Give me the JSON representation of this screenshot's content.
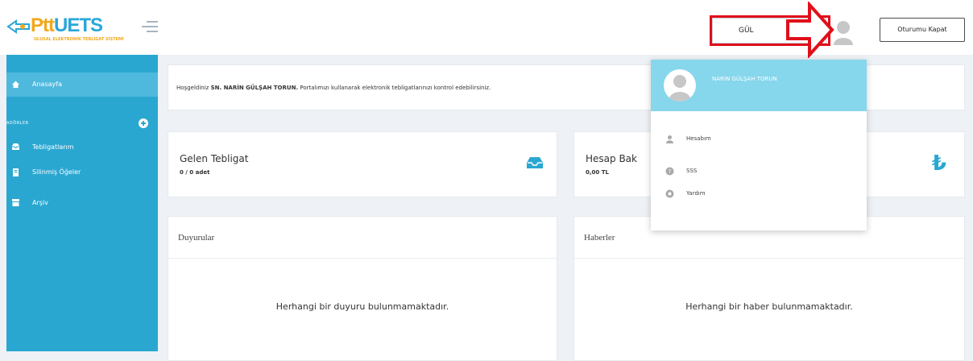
{
  "header": {
    "logo": {
      "brand_ptt": "Ptt",
      "brand_uets": "UETS",
      "tagline": "ULUSAL ELEKTRONİK TEBLİGAT SİSTEMİ"
    },
    "user_select": {
      "value": "GÜL"
    },
    "logout_label": "Oturumu Kapat"
  },
  "sidebar": {
    "home_label": "Anasayfa",
    "section_label": "ADÖRLER",
    "items": [
      {
        "label": "Tebligatlarım",
        "icon": "inbox-icon"
      },
      {
        "label": "Silinmiş Öğeler",
        "icon": "trash-icon"
      },
      {
        "label": "Arşiv",
        "icon": "archive-icon"
      }
    ]
  },
  "welcome": {
    "prefix": "Hoşgeldiniz",
    "name": "SN. NARİN GÜLŞAH TORUN.",
    "suffix": "Portalımızı kullanarak elektronik tebligatlarınızı kontrol edebilirsiniz."
  },
  "stats": {
    "gelen": {
      "title": "Gelen Tebligat",
      "value": "0 / 0 adet"
    },
    "hesap": {
      "title": "Hesap Bak",
      "value": "0,00 TL"
    }
  },
  "panels": {
    "duyurular": {
      "title": "Duyurular",
      "empty": "Herhangi bir duyuru bulunmamaktadır."
    },
    "haberler": {
      "title": "Haberler",
      "empty": "Herhangi bir haber bulunmamaktadır."
    }
  },
  "user_menu": {
    "name": "NARİN GÜLŞAH TORUN",
    "items": [
      {
        "label": "Hesabım",
        "icon": "user-icon"
      },
      {
        "label": "SSS",
        "icon": "question-icon"
      },
      {
        "label": "Yardım",
        "icon": "help-icon"
      }
    ]
  },
  "colors": {
    "accent": "#2aa7d1",
    "menu_header": "#86d6ec",
    "highlight": "#e10f1a"
  }
}
